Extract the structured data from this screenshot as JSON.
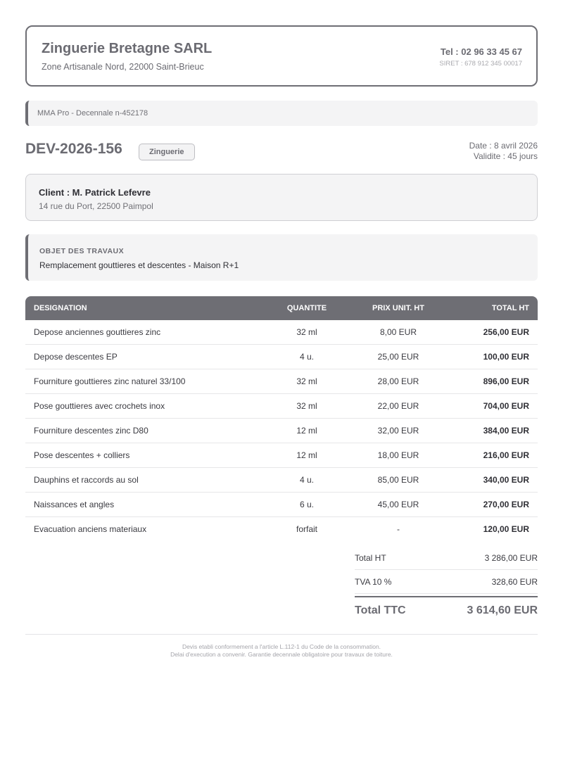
{
  "company": {
    "name": "Zinguerie Bretagne SARL",
    "address": "Zone Artisanale Nord, 22000 Saint-Brieuc",
    "phone": "Tel : 02 96 33 45 67",
    "siret": "SIRET : 678 912 345 00017"
  },
  "insurance": "MMA Pro - Decennale n-452178",
  "quote": {
    "number": "DEV-2026-156",
    "category": "Zinguerie",
    "date": "Date : 8 avril 2026",
    "validity": "Validite : 45 jours"
  },
  "client": {
    "name": "Client : M. Patrick Lefevre",
    "address": "14 rue du Port, 22500 Paimpol"
  },
  "works": {
    "title": "OBJET DES TRAVAUX",
    "description": "Remplacement gouttieres et descentes - Maison R+1"
  },
  "table": {
    "headers": {
      "designation": "DESIGNATION",
      "quantity": "QUANTITE",
      "unit_price": "PRIX UNIT. HT",
      "total": "TOTAL HT"
    },
    "rows": [
      {
        "designation": "Depose anciennes gouttieres zinc",
        "quantity": "32 ml",
        "unit_price": "8,00 EUR",
        "total": "256,00 EUR"
      },
      {
        "designation": "Depose descentes EP",
        "quantity": "4 u.",
        "unit_price": "25,00 EUR",
        "total": "100,00 EUR"
      },
      {
        "designation": "Fourniture gouttieres zinc naturel 33/100",
        "quantity": "32 ml",
        "unit_price": "28,00 EUR",
        "total": "896,00 EUR"
      },
      {
        "designation": "Pose gouttieres avec crochets inox",
        "quantity": "32 ml",
        "unit_price": "22,00 EUR",
        "total": "704,00 EUR"
      },
      {
        "designation": "Fourniture descentes zinc D80",
        "quantity": "12 ml",
        "unit_price": "32,00 EUR",
        "total": "384,00 EUR"
      },
      {
        "designation": "Pose descentes + colliers",
        "quantity": "12 ml",
        "unit_price": "18,00 EUR",
        "total": "216,00 EUR"
      },
      {
        "designation": "Dauphins et raccords au sol",
        "quantity": "4 u.",
        "unit_price": "85,00 EUR",
        "total": "340,00 EUR"
      },
      {
        "designation": "Naissances et angles",
        "quantity": "6 u.",
        "unit_price": "45,00 EUR",
        "total": "270,00 EUR"
      },
      {
        "designation": "Evacuation anciens materiaux",
        "quantity": "forfait",
        "unit_price": "-",
        "total": "120,00 EUR"
      }
    ]
  },
  "totals": {
    "ht_label": "Total HT",
    "ht_value": "3 286,00 EUR",
    "tva_label": "TVA 10 %",
    "tva_value": "328,60 EUR",
    "ttc_label": "Total TTC",
    "ttc_value": "3 614,60 EUR"
  },
  "footer": {
    "line1": "Devis etabli conformement a l'article L.112-1 du Code de la consommation.",
    "line2": "Delai d'execution a convenir. Garantie decennale obligatoire pour travaux de toiture."
  }
}
